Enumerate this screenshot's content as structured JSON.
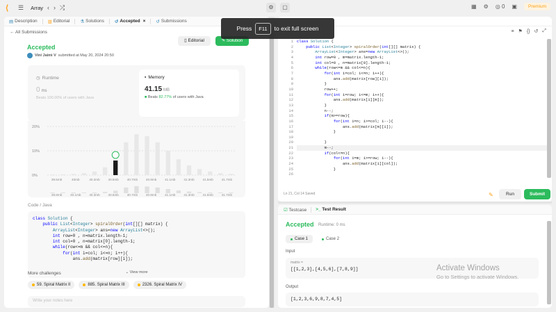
{
  "topbar": {
    "title": "Array",
    "premium": "Premium",
    "counter": "0"
  },
  "left_tabs": [
    {
      "label": "Description",
      "icon": "doc-icon"
    },
    {
      "label": "Editorial",
      "icon": "book-icon"
    },
    {
      "label": "Solutions",
      "icon": "flask-icon"
    },
    {
      "label": "Accepted",
      "icon": "history-icon",
      "active": true
    },
    {
      "label": "Submissions",
      "icon": "history-icon"
    }
  ],
  "all_submissions": "All Submissions",
  "result": {
    "status": "Accepted",
    "user": "Vini Jaimi V",
    "submitted": "submitted at May 20, 2024 20:50",
    "editorial_btn": "Editorial",
    "solution_btn": "Solution"
  },
  "runtime": {
    "label": "Runtime",
    "value": "0",
    "unit": "ms",
    "beats_prefix": "Beats",
    "beats_pct": "100.00%",
    "beats_suffix": "of users with Java"
  },
  "memory": {
    "label": "Memory",
    "value": "41.15",
    "unit": "MB",
    "beats_prefix": "Beats",
    "beats_pct": "82.77%",
    "beats_suffix": "of users with Java"
  },
  "chart_data": {
    "type": "bar",
    "ytick_labels": [
      "20%",
      "10%",
      "0%"
    ],
    "categories": [
      "39.5mb",
      "40mb",
      "40.2mb",
      "40.5mb",
      "40.7mb",
      "40.9mb",
      "41.1mb",
      "41.3mb",
      "41.5mb",
      "41.7mb"
    ],
    "overview_labels": [
      "39.8mb",
      "40.1mb",
      "40.3mb",
      "40.6mb",
      "40.7mb",
      "40.9mb",
      "41.1mb",
      "41.3mb",
      "41.5mb",
      "41.7mb"
    ],
    "values": [
      0.2,
      0.3,
      0.5,
      0.8,
      1.5,
      3.2,
      6.0,
      13.5,
      16.8,
      16.0,
      13.5,
      10.0,
      6.5,
      4.0,
      2.5,
      1.5,
      0.8,
      0.5
    ],
    "highlight_index": 6,
    "ylim": [
      0,
      20
    ]
  },
  "code_section": {
    "label": "Code",
    "lang": "Java",
    "lines": [
      "class Solution {",
      "    public List<Integer> spiralOrder(int[][] matrix) {",
      "        ArrayList<Integer> ans=new ArrayList<>();",
      "        int row=0 , n=matrix.length-1;",
      "        int col=0 , n=matrix[0].length-1;",
      "        while(row<=m && col<=n){",
      "            for(int i=col; i<=n; i++){",
      "                ans.add(matrix[row][i]);"
    ],
    "view_more": "View more"
  },
  "more_challenges": {
    "label": "More challenges",
    "items": [
      "59. Spiral Matrix II",
      "885. Spiral Matrix III",
      "2326. Spiral Matrix IV"
    ]
  },
  "notes_placeholder": "Write your notes here",
  "editor": {
    "lines": [
      "class Solution {",
      "    public List<Integer> spiralOrder(int[][] matrix) {",
      "        ArrayList<Integer> ans=new ArrayList<>();",
      "        int row=0 , m=matrix.length-1;",
      "        int col=0 , n=matrix[0].length-1;",
      "        while(row<=m && col<=n){",
      "            for(int i=col; i<=n; i++){",
      "                ans.add(matrix[row][i]);",
      "            }",
      "            row++;",
      "            for(int i=row; i<=m; i++){",
      "                ans.add(matrix[i][m]);",
      "            }",
      "            n--;",
      "            if(m>=row){",
      "                for(int i=n; i>=col; i--){",
      "                    ans.add(matrix[m][i]);",
      "                }",
      "",
      "            }",
      "            m--;",
      "            if(col<=n){",
      "                for(int i=m; i>=row; i--){",
      "                    ans.add(matrix[i][col]);",
      "                }",
      ""
    ],
    "highlight_line": 21,
    "status": "Ln 21, Col 14   Saved",
    "run": "Run",
    "submit": "Submit"
  },
  "testcase": {
    "tab1": "Testcase",
    "tab2": "Test Result",
    "status": "Accepted",
    "runtime": "Runtime: 0 ms",
    "cases": [
      "Case 1",
      "Case 2"
    ],
    "input_label": "Input",
    "input_sub": "matrix =",
    "input_value": "[[1,2,3],[4,5,6],[7,8,9]]",
    "output_label": "Output",
    "output_value": "[1,2,3,6,9,8,7,4,5]"
  },
  "fullscreen": {
    "press": "Press",
    "key": "F11",
    "rest": "to exit full screen"
  },
  "watermark": {
    "line1": "Activate Windows",
    "line2": "Go to Settings to activate Windows."
  },
  "colors": {
    "accent": "#2cbb5d",
    "brand": "#ffa116"
  }
}
